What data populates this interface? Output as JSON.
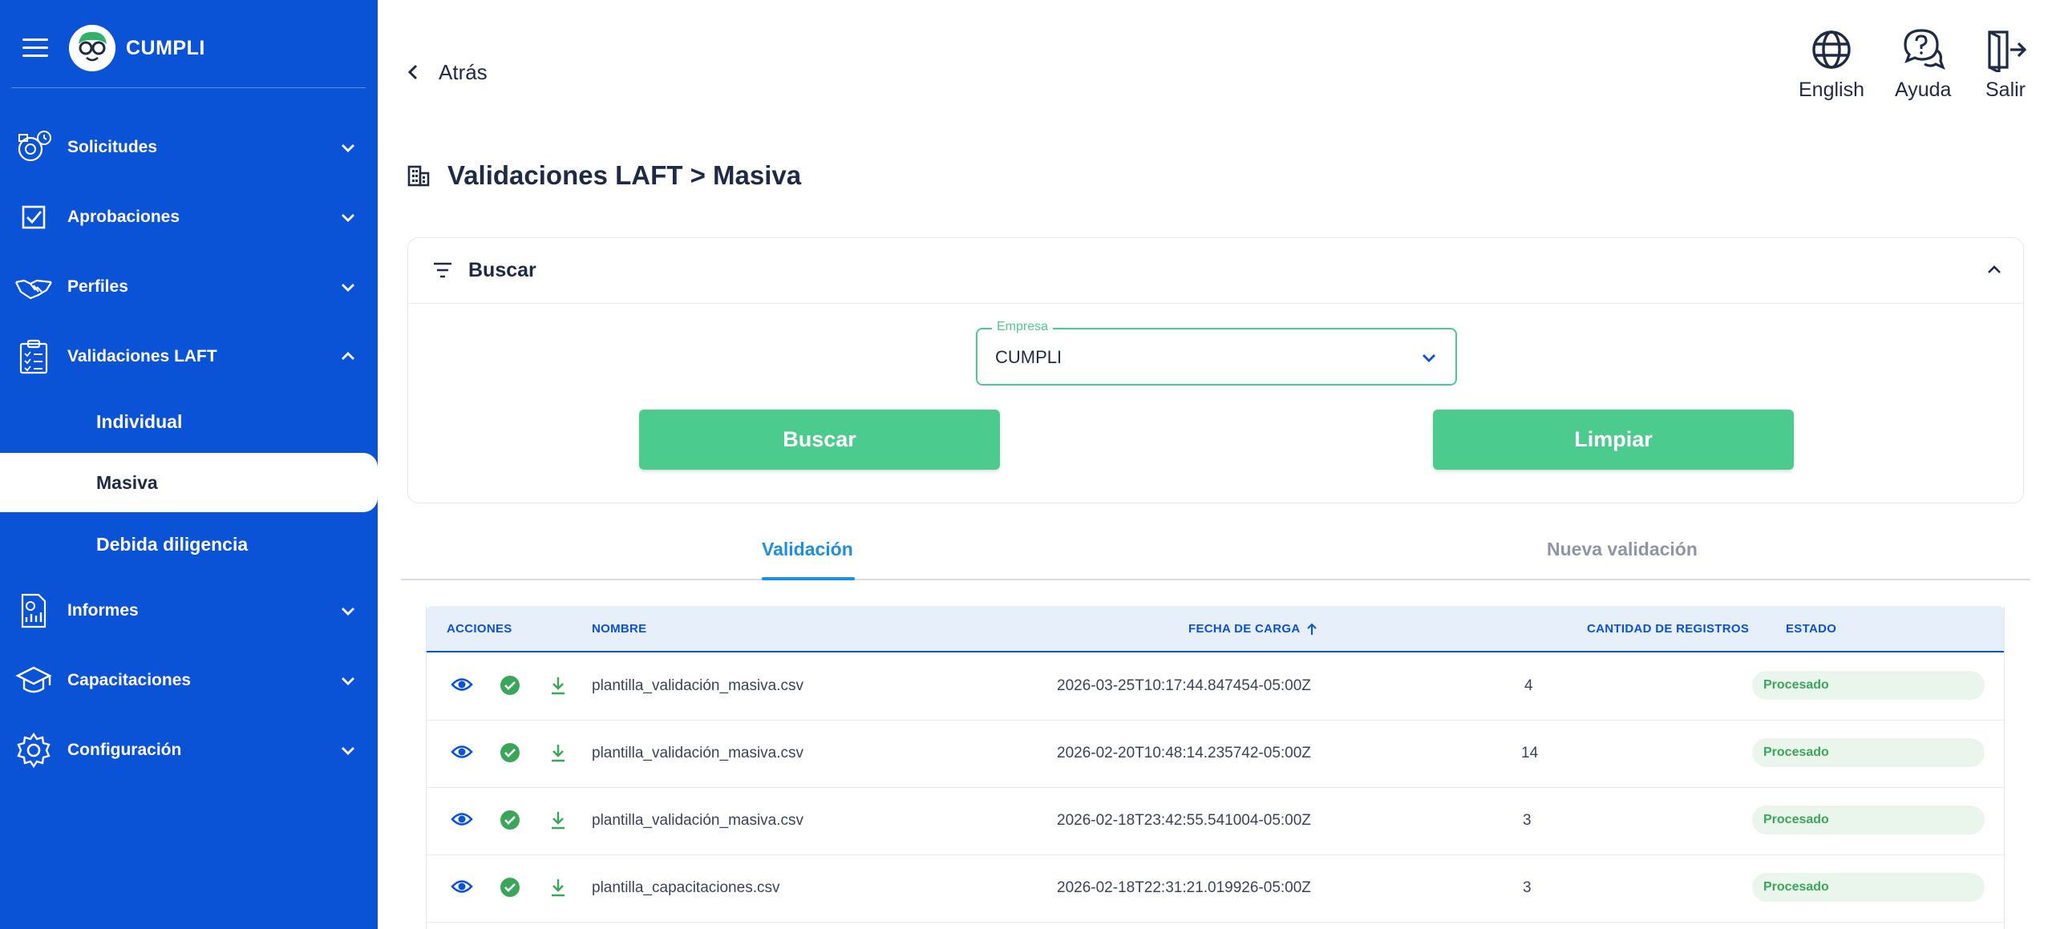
{
  "app": {
    "brand": "CUMPLI"
  },
  "sidebar": {
    "items": [
      {
        "label": "Solicitudes",
        "icon": "requests-icon",
        "expanded": false
      },
      {
        "label": "Aprobaciones",
        "icon": "checkbox-icon",
        "expanded": false
      },
      {
        "label": "Perfiles",
        "icon": "handshake-icon",
        "expanded": false
      },
      {
        "label": "Validaciones LAFT",
        "icon": "clipboard-icon",
        "expanded": true
      },
      {
        "label": "Informes",
        "icon": "report-icon",
        "expanded": false
      },
      {
        "label": "Capacitaciones",
        "icon": "graduation-cap-icon",
        "expanded": false
      },
      {
        "label": "Configuración",
        "icon": "gear-icon",
        "expanded": false
      }
    ],
    "subitems": [
      {
        "label": "Individual",
        "active": false
      },
      {
        "label": "Masiva",
        "active": true
      },
      {
        "label": "Debida diligencia",
        "active": false
      }
    ]
  },
  "topbar": {
    "back_label": "Atrás",
    "language_label": "English",
    "help_label": "Ayuda",
    "logout_label": "Salir"
  },
  "page": {
    "title": "Validaciones LAFT > Masiva"
  },
  "search": {
    "title": "Buscar",
    "company_legend": "Empresa",
    "company_value": "CUMPLI",
    "search_button": "Buscar",
    "clear_button": "Limpiar"
  },
  "tabs": [
    {
      "label": "Validación",
      "active": true
    },
    {
      "label": "Nueva validación",
      "active": false
    }
  ],
  "table": {
    "headers": {
      "actions": "ACCIONES",
      "name": "NOMBRE",
      "date": "FECHA DE CARGA",
      "count": "CANTIDAD DE REGISTROS",
      "status": "ESTADO"
    },
    "rows": [
      {
        "name": "plantilla_validación_masiva.csv",
        "date": "2026-03-25T10:17:44.847454-05:00Z",
        "count": "4",
        "status": "Procesado"
      },
      {
        "name": "plantilla_validación_masiva.csv",
        "date": "2026-02-20T10:48:14.235742-05:00Z",
        "count": "14",
        "status": "Procesado"
      },
      {
        "name": "plantilla_validación_masiva.csv",
        "date": "2026-02-18T23:42:55.541004-05:00Z",
        "count": "3",
        "status": "Procesado"
      },
      {
        "name": "plantilla_capacitaciones.csv",
        "date": "2026-02-18T22:31:21.019926-05:00Z",
        "count": "3",
        "status": "Procesado"
      }
    ]
  },
  "colors": {
    "sidebar": "#0a52d6",
    "accent_green": "#4ccb8e",
    "tab_blue": "#1d8fe0",
    "status_green": "#3aa65a"
  }
}
